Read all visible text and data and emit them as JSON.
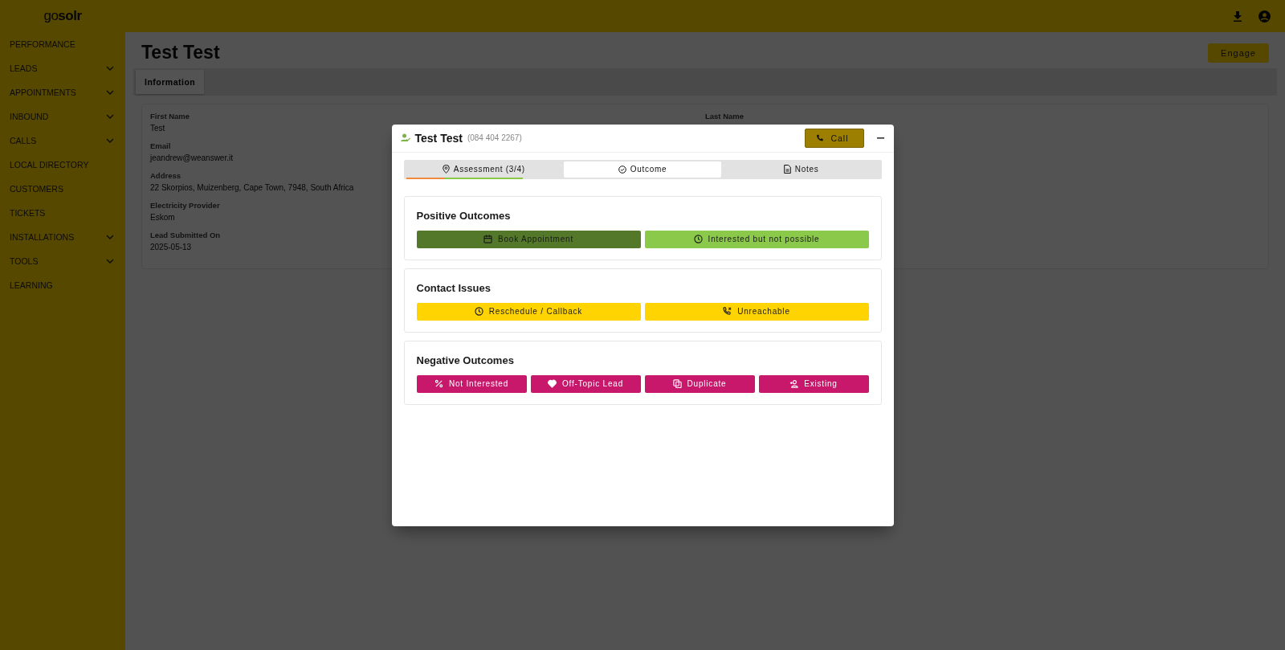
{
  "brand": {
    "logo": "go**solr**"
  },
  "sidebar": {
    "items": [
      {
        "label": "PERFORMANCE",
        "expandable": false
      },
      {
        "label": "LEADS",
        "expandable": true
      },
      {
        "label": "APPOINTMENTS",
        "expandable": true
      },
      {
        "label": "INBOUND",
        "expandable": true
      },
      {
        "label": "CALLS",
        "expandable": true
      },
      {
        "label": "LOCAL DIRECTORY",
        "expandable": false
      },
      {
        "label": "CUSTOMERS",
        "expandable": false
      },
      {
        "label": "TICKETS",
        "expandable": false
      },
      {
        "label": "INSTALLATIONS",
        "expandable": true
      },
      {
        "label": "TOOLS",
        "expandable": true
      },
      {
        "label": "LEARNING",
        "expandable": false
      }
    ]
  },
  "page": {
    "title": "Test Test",
    "engage_button": "Engage",
    "tabs": [
      {
        "label": "Information",
        "selected": true
      }
    ],
    "left_fields": [
      {
        "label": "First Name",
        "value": "Test"
      },
      {
        "label": "Email",
        "value": "jeandrew@weanswer.it"
      },
      {
        "label": "Address",
        "value": "22 Skorpios, Muizenberg, Cape Town, 7948, South Africa"
      },
      {
        "label": "Electricity Provider",
        "value": "Eskom"
      },
      {
        "label": "Lead Submitted On",
        "value": "2025-05-13"
      }
    ],
    "right_fields": [
      {
        "label": "Last Name"
      }
    ]
  },
  "modal": {
    "title": "Test Test",
    "phone": "(084 404 2267)",
    "call_button": "Call",
    "tabs": [
      {
        "label": "Assessment (3/4)",
        "selected": false,
        "level": 0.75
      },
      {
        "label": "Outcome",
        "selected": true
      },
      {
        "label": "Notes",
        "selected": false
      }
    ],
    "sections": [
      {
        "title": "Positive Outcomes",
        "buttons": [
          {
            "label": "Book Appointment",
            "color": "#53782a"
          },
          {
            "label": "Interested but not possible",
            "color": "#8bc94a"
          }
        ]
      },
      {
        "title": "Contact Issues",
        "buttons": [
          {
            "label": "Reschedule / Callback",
            "color": "#ffd400"
          },
          {
            "label": "Unreachable",
            "color": "#ffd400"
          }
        ]
      },
      {
        "title": "Negative Outcomes",
        "buttons": [
          {
            "label": "Not Interested",
            "color": "#c8186c"
          },
          {
            "label": "Off-Topic Lead",
            "color": "#c8186c"
          },
          {
            "label": "Duplicate",
            "color": "#c8186c"
          },
          {
            "label": "Existing",
            "color": "#c8186c"
          }
        ]
      }
    ]
  }
}
